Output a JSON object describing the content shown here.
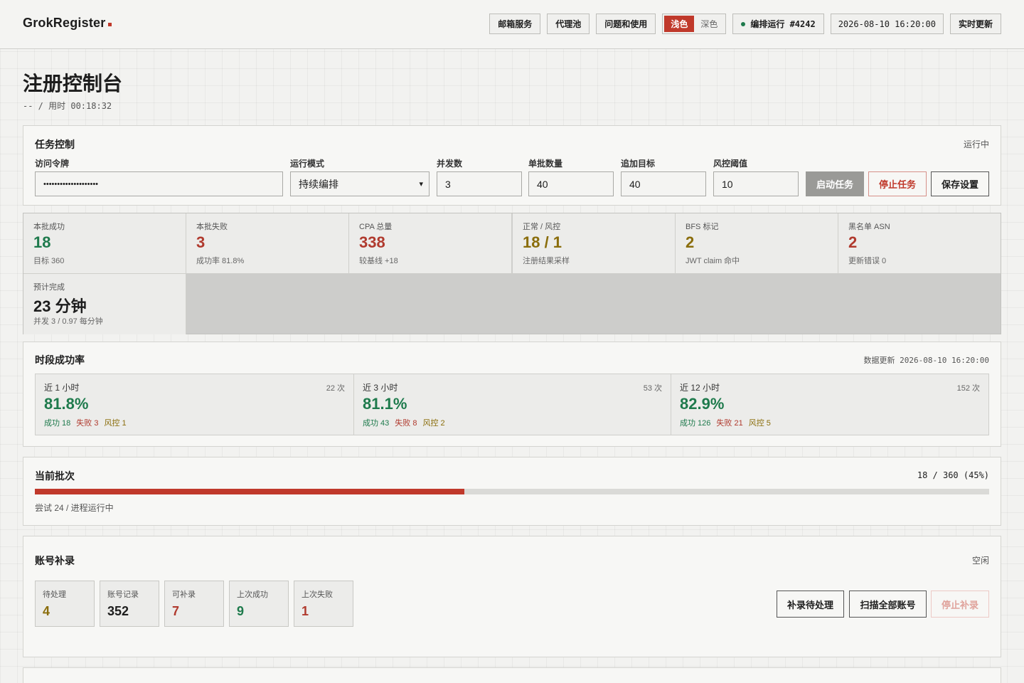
{
  "header": {
    "brand": "GrokRegister",
    "nav": [
      "邮箱服务",
      "代理池",
      "问题和使用"
    ],
    "theme_light": "浅色",
    "theme_dark": "深色",
    "run_status": "编排运行 #4242",
    "timestamp": "2026-08-10 16:20:00",
    "refresh": "实时更新"
  },
  "page": {
    "title": "注册控制台",
    "subtitle": "-- / 用时 00:18:32"
  },
  "task": {
    "title": "任务控制",
    "status": "运行中",
    "token_label": "访问令牌",
    "token_value": "••••••••••••••••••••",
    "mode_label": "运行模式",
    "mode_value": "持续编排",
    "concurrency_label": "并发数",
    "concurrency_value": "3",
    "batch_label": "单批数量",
    "batch_value": "40",
    "target_label": "追加目标",
    "target_value": "40",
    "risk_label": "风控阈值",
    "risk_value": "10",
    "start": "启动任务",
    "stop": "停止任务",
    "save": "保存设置"
  },
  "stats": [
    {
      "label": "本批成功",
      "value": "18",
      "sub": "目标 360",
      "color": "#1e7a4c"
    },
    {
      "label": "本批失败",
      "value": "3",
      "sub": "成功率 81.8%",
      "color": "#b03a2e"
    },
    {
      "label": "CPA 总量",
      "value": "338",
      "sub": "较基线 +18",
      "color": "#b03a2e"
    },
    {
      "label": "正常 / 风控",
      "value": "18 / 1",
      "sub": "注册结果采样",
      "color": "#8a6d0b"
    },
    {
      "label": "BFS 标记",
      "value": "2",
      "sub": "JWT claim 命中",
      "color": "#8a6d0b"
    },
    {
      "label": "黑名单 ASN",
      "value": "2",
      "sub": "更新错误 0",
      "color": "#b03a2e"
    },
    {
      "label": "预计完成",
      "value": "23 分钟",
      "sub": "并发 3 / 0.97 每分钟",
      "color": "#1d1d1d"
    }
  ],
  "period": {
    "title": "时段成功率",
    "updated": "数据更新 2026-08-10 16:20:00",
    "items": [
      {
        "label": "近 1 小时",
        "count": "22 次",
        "rate": "81.8%",
        "ok": "成功 18",
        "fail": "失败 3",
        "risk": "风控 1"
      },
      {
        "label": "近 3 小时",
        "count": "53 次",
        "rate": "81.1%",
        "ok": "成功 43",
        "fail": "失败 8",
        "risk": "风控 2"
      },
      {
        "label": "近 12 小时",
        "count": "152 次",
        "rate": "82.9%",
        "ok": "成功 126",
        "fail": "失败 21",
        "risk": "风控 5"
      }
    ]
  },
  "batch": {
    "title": "当前批次",
    "progress_text": "18 / 360 (45%)",
    "progress": 0.45,
    "note": "尝试 24 / 进程运行中"
  },
  "accounts": {
    "title": "账号补录",
    "status": "空闲",
    "items": [
      {
        "label": "待处理",
        "value": "4",
        "color": "#8a6d0b"
      },
      {
        "label": "账号记录",
        "value": "352",
        "color": "#1d1d1d"
      },
      {
        "label": "可补录",
        "value": "7",
        "color": "#b03a2e"
      },
      {
        "label": "上次成功",
        "value": "9",
        "color": "#1e7a4c"
      },
      {
        "label": "上次失败",
        "value": "1",
        "color": "#b03a2e"
      }
    ],
    "btn_pending": "补录待处理",
    "btn_scan": "扫描全部账号",
    "btn_stop": "停止补录"
  },
  "colors": {
    "accent": "#c0392b",
    "success": "#1e7a4c",
    "danger": "#b03a2e",
    "warn": "#8a6d0b"
  }
}
